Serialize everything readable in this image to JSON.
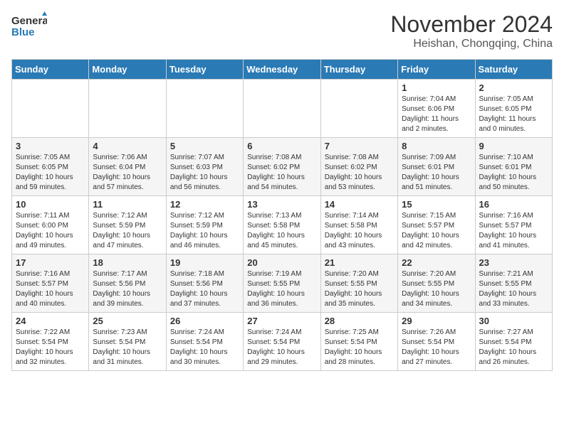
{
  "header": {
    "logo_general": "General",
    "logo_blue": "Blue",
    "month_title": "November 2024",
    "location": "Heishan, Chongqing, China"
  },
  "days_of_week": [
    "Sunday",
    "Monday",
    "Tuesday",
    "Wednesday",
    "Thursday",
    "Friday",
    "Saturday"
  ],
  "weeks": [
    [
      {
        "day": "",
        "info": ""
      },
      {
        "day": "",
        "info": ""
      },
      {
        "day": "",
        "info": ""
      },
      {
        "day": "",
        "info": ""
      },
      {
        "day": "",
        "info": ""
      },
      {
        "day": "1",
        "info": "Sunrise: 7:04 AM\nSunset: 6:06 PM\nDaylight: 11 hours and 2 minutes."
      },
      {
        "day": "2",
        "info": "Sunrise: 7:05 AM\nSunset: 6:05 PM\nDaylight: 11 hours and 0 minutes."
      }
    ],
    [
      {
        "day": "3",
        "info": "Sunrise: 7:05 AM\nSunset: 6:05 PM\nDaylight: 10 hours and 59 minutes."
      },
      {
        "day": "4",
        "info": "Sunrise: 7:06 AM\nSunset: 6:04 PM\nDaylight: 10 hours and 57 minutes."
      },
      {
        "day": "5",
        "info": "Sunrise: 7:07 AM\nSunset: 6:03 PM\nDaylight: 10 hours and 56 minutes."
      },
      {
        "day": "6",
        "info": "Sunrise: 7:08 AM\nSunset: 6:02 PM\nDaylight: 10 hours and 54 minutes."
      },
      {
        "day": "7",
        "info": "Sunrise: 7:08 AM\nSunset: 6:02 PM\nDaylight: 10 hours and 53 minutes."
      },
      {
        "day": "8",
        "info": "Sunrise: 7:09 AM\nSunset: 6:01 PM\nDaylight: 10 hours and 51 minutes."
      },
      {
        "day": "9",
        "info": "Sunrise: 7:10 AM\nSunset: 6:01 PM\nDaylight: 10 hours and 50 minutes."
      }
    ],
    [
      {
        "day": "10",
        "info": "Sunrise: 7:11 AM\nSunset: 6:00 PM\nDaylight: 10 hours and 49 minutes."
      },
      {
        "day": "11",
        "info": "Sunrise: 7:12 AM\nSunset: 5:59 PM\nDaylight: 10 hours and 47 minutes."
      },
      {
        "day": "12",
        "info": "Sunrise: 7:12 AM\nSunset: 5:59 PM\nDaylight: 10 hours and 46 minutes."
      },
      {
        "day": "13",
        "info": "Sunrise: 7:13 AM\nSunset: 5:58 PM\nDaylight: 10 hours and 45 minutes."
      },
      {
        "day": "14",
        "info": "Sunrise: 7:14 AM\nSunset: 5:58 PM\nDaylight: 10 hours and 43 minutes."
      },
      {
        "day": "15",
        "info": "Sunrise: 7:15 AM\nSunset: 5:57 PM\nDaylight: 10 hours and 42 minutes."
      },
      {
        "day": "16",
        "info": "Sunrise: 7:16 AM\nSunset: 5:57 PM\nDaylight: 10 hours and 41 minutes."
      }
    ],
    [
      {
        "day": "17",
        "info": "Sunrise: 7:16 AM\nSunset: 5:57 PM\nDaylight: 10 hours and 40 minutes."
      },
      {
        "day": "18",
        "info": "Sunrise: 7:17 AM\nSunset: 5:56 PM\nDaylight: 10 hours and 39 minutes."
      },
      {
        "day": "19",
        "info": "Sunrise: 7:18 AM\nSunset: 5:56 PM\nDaylight: 10 hours and 37 minutes."
      },
      {
        "day": "20",
        "info": "Sunrise: 7:19 AM\nSunset: 5:55 PM\nDaylight: 10 hours and 36 minutes."
      },
      {
        "day": "21",
        "info": "Sunrise: 7:20 AM\nSunset: 5:55 PM\nDaylight: 10 hours and 35 minutes."
      },
      {
        "day": "22",
        "info": "Sunrise: 7:20 AM\nSunset: 5:55 PM\nDaylight: 10 hours and 34 minutes."
      },
      {
        "day": "23",
        "info": "Sunrise: 7:21 AM\nSunset: 5:55 PM\nDaylight: 10 hours and 33 minutes."
      }
    ],
    [
      {
        "day": "24",
        "info": "Sunrise: 7:22 AM\nSunset: 5:54 PM\nDaylight: 10 hours and 32 minutes."
      },
      {
        "day": "25",
        "info": "Sunrise: 7:23 AM\nSunset: 5:54 PM\nDaylight: 10 hours and 31 minutes."
      },
      {
        "day": "26",
        "info": "Sunrise: 7:24 AM\nSunset: 5:54 PM\nDaylight: 10 hours and 30 minutes."
      },
      {
        "day": "27",
        "info": "Sunrise: 7:24 AM\nSunset: 5:54 PM\nDaylight: 10 hours and 29 minutes."
      },
      {
        "day": "28",
        "info": "Sunrise: 7:25 AM\nSunset: 5:54 PM\nDaylight: 10 hours and 28 minutes."
      },
      {
        "day": "29",
        "info": "Sunrise: 7:26 AM\nSunset: 5:54 PM\nDaylight: 10 hours and 27 minutes."
      },
      {
        "day": "30",
        "info": "Sunrise: 7:27 AM\nSunset: 5:54 PM\nDaylight: 10 hours and 26 minutes."
      }
    ]
  ]
}
